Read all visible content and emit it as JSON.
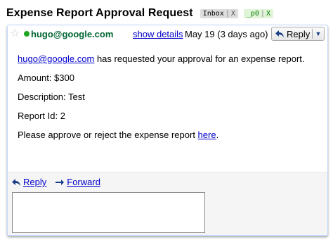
{
  "thread": {
    "subject": "Expense Report Approval Request",
    "labels": [
      {
        "name": "Inbox",
        "remove": "X"
      },
      {
        "name": "_p0",
        "remove": "X"
      }
    ]
  },
  "message": {
    "sender": "hugo@google.com",
    "show_details": "show details",
    "date": "May 19 (3 days ago)",
    "reply_button": "Reply",
    "body": {
      "requester_link": "hugo@google.com",
      "requester_text": " has requested your approval for an expense report.",
      "amount": "Amount: $300",
      "description": "Description: Test",
      "report_id": "Report Id: 2",
      "approve_text": "Please approve or reject the expense report ",
      "here_link": "here",
      "trailing": "."
    }
  },
  "footer": {
    "reply": "Reply",
    "forward": "Forward"
  },
  "colors": {
    "sender": "#006633",
    "link": "#0000cc",
    "card_border": "#c3d9ff",
    "label_po_bg": "#e0f5d8",
    "label_po_text": "#0b7a06"
  }
}
